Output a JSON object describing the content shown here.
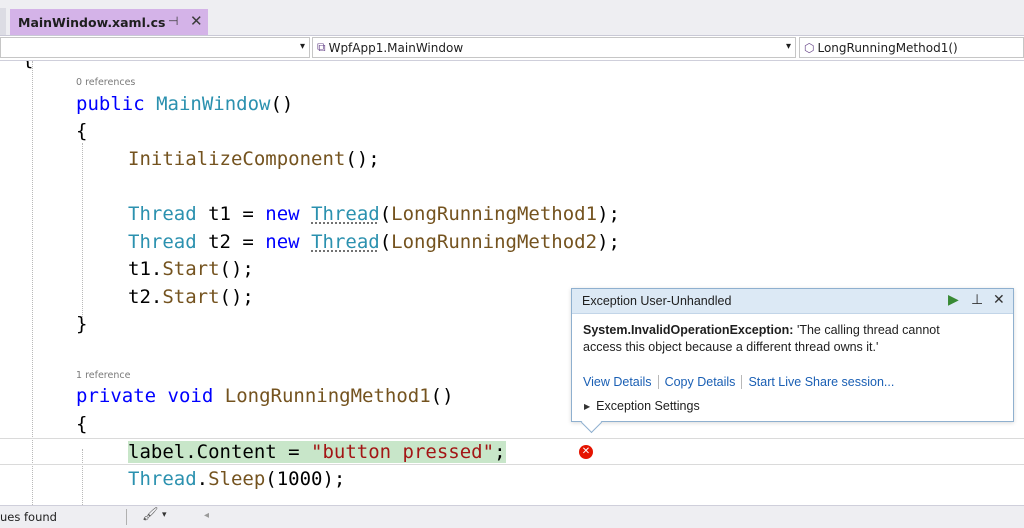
{
  "tab": {
    "title": "MainWindow.xaml.cs",
    "pin_glyph": "⊣",
    "close_glyph": "✕",
    "accent": "#d4b3e8"
  },
  "navbar": {
    "project_value": "",
    "type_value": "WpfApp1.MainWindow",
    "member_value": "LongRunningMethod1()",
    "dropdown_arrow": "▾"
  },
  "editor": {
    "refs_0": "0 references",
    "refs_1": "1 reference",
    "line_brace_top": "{",
    "ctor_public": "public",
    "ctor_name": "MainWindow",
    "ctor_parens": "()",
    "open_brace": "{",
    "close_brace": "}",
    "init_name": "InitializeComponent",
    "init_rest": "();",
    "thread_type": "Thread",
    "t1_decl": " t1 = ",
    "t2_decl": " t2 = ",
    "new_kw": "new",
    "thread_ctor": "Thread",
    "paren_open": "(",
    "lrm1": "LongRunningMethod1",
    "lrm2": "LongRunningMethod2",
    "paren_close_semi": ");",
    "t1_obj": "t1.",
    "t2_obj": "t2.",
    "start_name": "Start",
    "start_rest": "();",
    "private_kw": "private",
    "void_kw": "void",
    "method1_name": "LongRunningMethod1",
    "method_parens": "()",
    "label_assign": "label.Content = ",
    "button_str": "\"button pressed\"",
    "semi": ";",
    "thread_dot": "Thread",
    "sleep_dot": ".",
    "sleep_name": "Sleep",
    "sleep_args": "(1000);"
  },
  "exception": {
    "title": "Exception User-Unhandled",
    "continue_icon": "▶",
    "pin_icon": "⊥",
    "close_icon": "✕",
    "type": "System.InvalidOperationException:",
    "message_line1": " 'The calling thread cannot",
    "message_line2": "access this object because a different thread owns it.'",
    "link_view": "View Details",
    "link_copy": "Copy Details",
    "link_share": "Start Live Share session...",
    "settings_glyph": "▶",
    "settings": "Exception Settings",
    "continue_color": "#388a34"
  },
  "error_glyph": "✕",
  "status": {
    "text": "ues found",
    "brush_glyph": "🖌",
    "caret_glyph": "▾",
    "scroll_glyph": "◂"
  }
}
